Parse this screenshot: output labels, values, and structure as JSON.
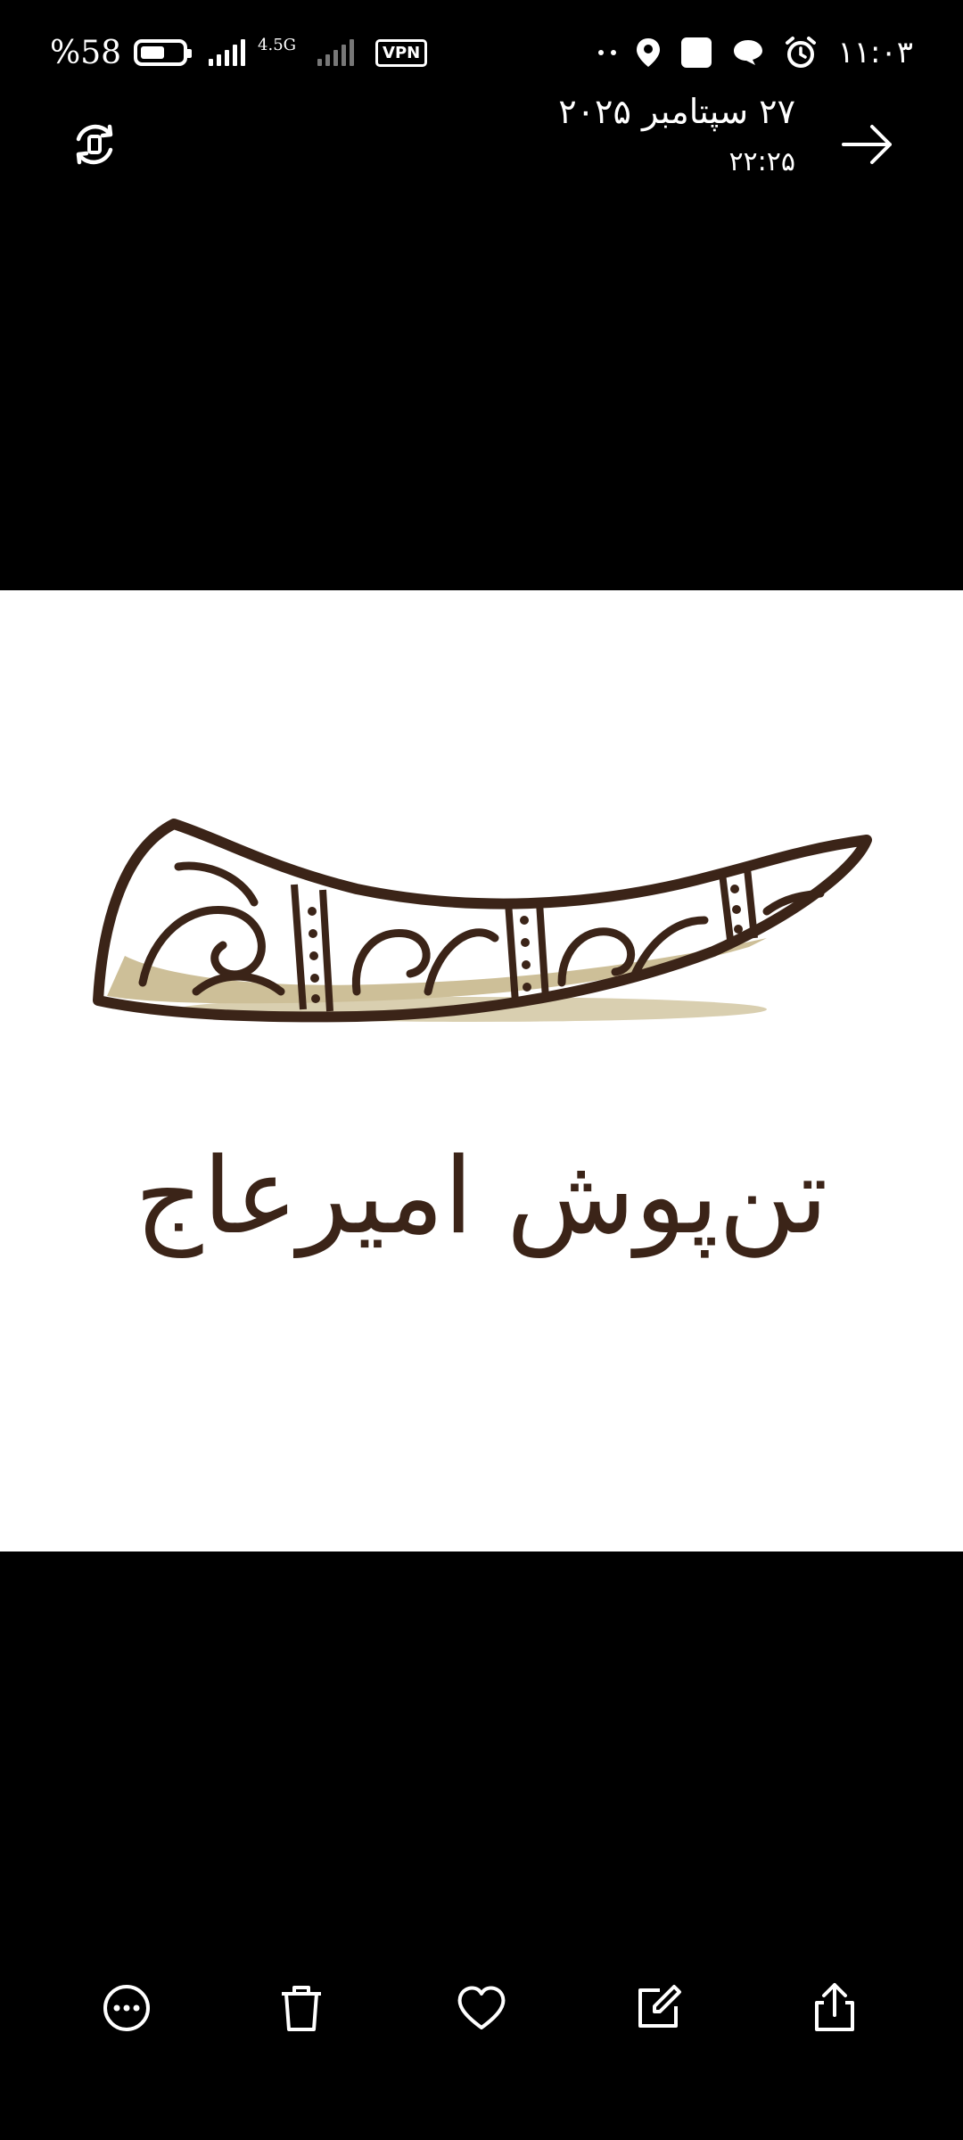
{
  "status_bar": {
    "battery_percent": "%58",
    "battery_level": 0.58,
    "network_type": "4.5G",
    "vpn_label": "VPN",
    "clock": "۱۱:۰۳"
  },
  "header": {
    "date": "۲۷ سپتامبر ۲۰۲۵",
    "time": "۲۲:۲۵"
  },
  "photo": {
    "logo_text": "تن‌پوش امیرعاج",
    "colors": {
      "brown": "#3b2418",
      "beige": "#cdbf98",
      "background": "#ffffff"
    }
  },
  "toolbar": {
    "icons": [
      "more-icon",
      "delete-icon",
      "favorite-icon",
      "edit-icon",
      "share-icon"
    ]
  }
}
